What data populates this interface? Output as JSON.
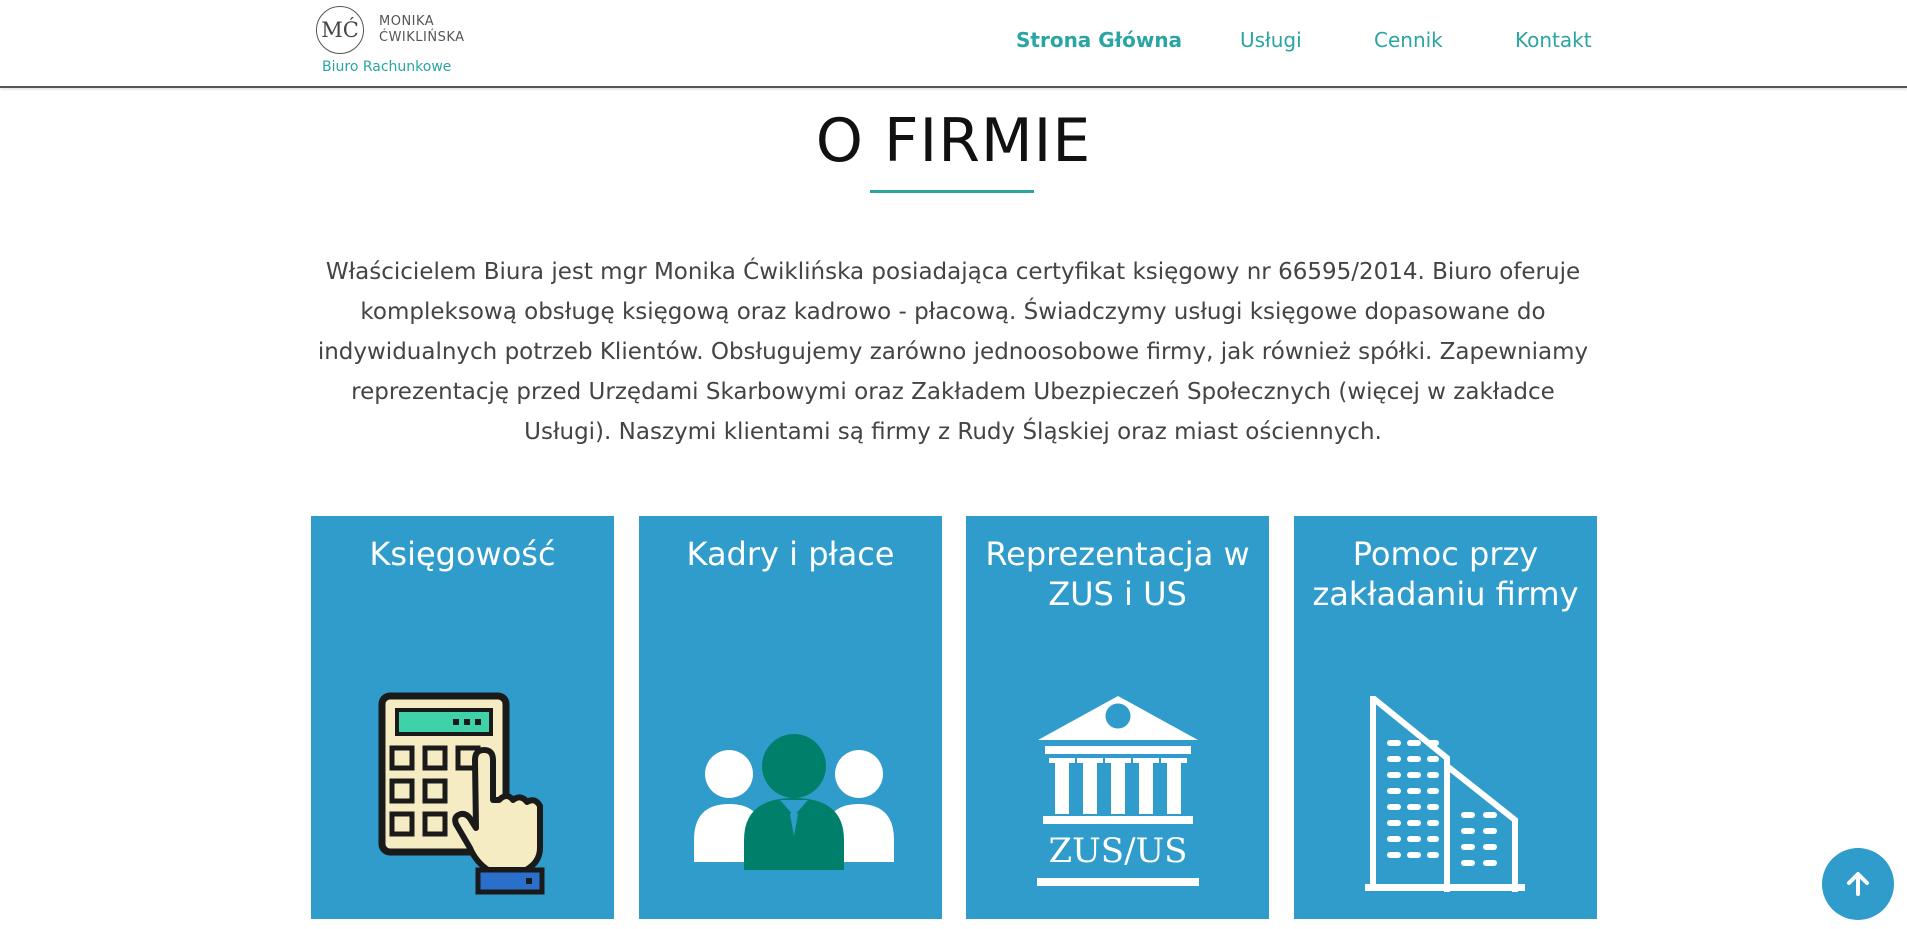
{
  "logo": {
    "monogram": "MĆ",
    "name_line1": "MONIKA",
    "name_line2": "ĆWIKLIŃSKA",
    "tagline": "Biuro Rachunkowe"
  },
  "nav": {
    "items": [
      {
        "label": "Strona Główna",
        "active": true
      },
      {
        "label": "Usługi",
        "active": false
      },
      {
        "label": "Cennik",
        "active": false
      },
      {
        "label": "Kontakt",
        "active": false
      }
    ]
  },
  "about": {
    "title": "O FIRMIE",
    "text": "Właścicielem Biura jest mgr Monika Ćwiklińska posiadająca certyfikat księgowy nr 66595/2014. Biuro oferuje kompleksową obsługę księgową oraz kadrowo - płacową. Świadczymy usługi księgowe dopasowane do indywidualnych potrzeb Klientów. Obsługujemy zarówno jednoosobowe firmy, jak również spółki. Zapewniamy reprezentację przed Urzędami Skarbowymi oraz Zakładem Ubezpieczeń Społecznych (więcej w zakładce Usługi). Naszymi klientami są firmy z Rudy Śląskiej oraz miast ościennych."
  },
  "services": [
    {
      "title": "Księgowość",
      "icon": "calculator-icon"
    },
    {
      "title": "Kadry i płace",
      "icon": "team-icon"
    },
    {
      "title": "Reprezentacja w ZUS i US",
      "icon": "government-building-icon",
      "icon_text": "ZUS/US"
    },
    {
      "title": "Pomoc przy zakładaniu firmy",
      "icon": "office-buildings-icon"
    }
  ],
  "colors": {
    "accent": "#2ba4a4",
    "card_bg": "#2f9ccb",
    "header_border": "#555555"
  },
  "back_to_top": {
    "icon": "arrow-up-icon"
  }
}
